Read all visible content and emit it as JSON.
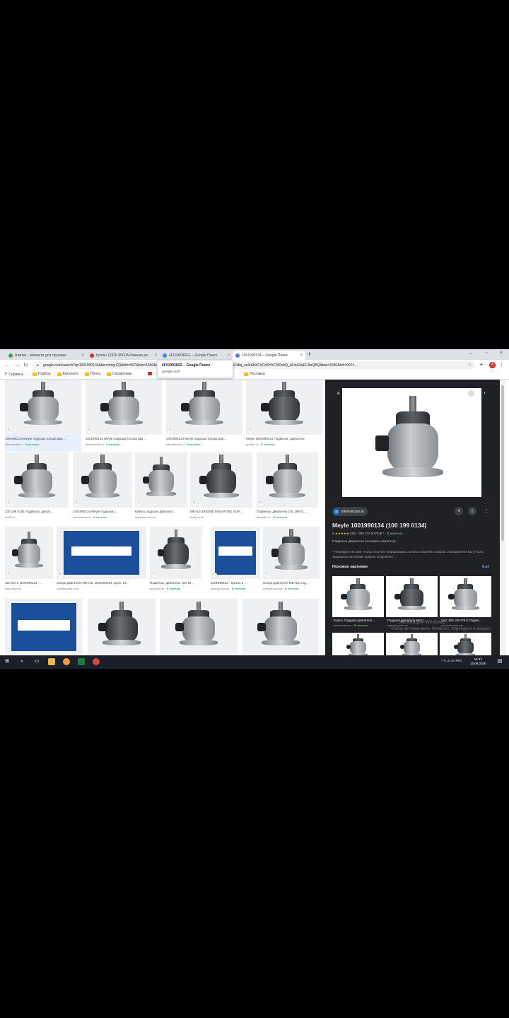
{
  "browser": {
    "tabs": [
      {
        "label": "Алитек - запчасти для грузовик",
        "color": "#34a853",
        "active": false
      },
      {
        "label": "Куплю 11920-95F0A Резинка ре",
        "color": "#d93025",
        "active": false
      },
      {
        "label": "4F0199381FL – Google Поиск",
        "color": "#4285f4",
        "active": false
      },
      {
        "label": "1001990134 – Google Поиск",
        "color": "#4285f4",
        "active": true
      }
    ],
    "new_tab": "+",
    "url": "google.com/search?q=1001990134&tbs=rimg:CQ&bih=907&biw=1680&ved=2ahUKEwi&tbm=isch&sa=X&ved=2ahUKEwiZ4bq_ve3rAhXFXCcKHXCNDukQ_AUoA3oECAsQBQ&biw=1680&bih=907#…",
    "bookmarks": [
      {
        "label": "Сервисы",
        "type": "grid"
      },
      {
        "label": "Подбор",
        "type": "folder"
      },
      {
        "label": "Каталоги",
        "type": "folder"
      },
      {
        "label": "Почта",
        "type": "folder"
      },
      {
        "label": "Справочник",
        "type": "folder"
      },
      {
        "label": "Поставка",
        "type": "folder"
      }
    ],
    "tooltip": {
      "title": "4F0199381R – Google Поиск",
      "domain": "google.com"
    }
  },
  "results": [
    {
      "caption": "1001990134 Meyle подушка (опора дви…",
      "source": "internetcars.ru",
      "stock": "В наличии",
      "style": "mount",
      "selected": true
    },
    {
      "caption": "1001990134 Meyle подушка (опора дви…",
      "source": "internetcars.ru",
      "stock": "В наличии",
      "style": "mount"
    },
    {
      "caption": "1001990134 Meyle подушка (опора дви…",
      "source": "internetcars.ru",
      "stock": "В наличии",
      "style": "mount"
    },
    {
      "caption": "Meyle 1001990134 Подвеска, двигатель",
      "source": "zpolitre.ru",
      "stock": "В наличии",
      "style": "mount"
    },
    {
      "caption": "100 199 0134 Подвеска, двигат…",
      "source": "port3.ru",
      "stock": "",
      "style": "mount"
    },
    {
      "caption": "1001990134 Meyle подушка (…",
      "source": "internetcars.ru",
      "stock": "В наличии",
      "style": "mount"
    },
    {
      "caption": "Купить подушка двигател…",
      "source": "avtoplus.com.ua",
      "stock": "",
      "style": "mount"
    },
    {
      "caption": "MEYLE ENGINE MOUNTING SUP…",
      "source": "ebay.co.uk",
      "stock": "",
      "style": "mount"
    },
    {
      "caption": "Подвеска, двигатель 100 199 01…",
      "source": "autoplex.ru",
      "stock": "В наличии",
      "style": "mount"
    },
    {
      "caption": "Запчасть 1001990134 -…",
      "source": "baza.dnpri.ru",
      "stock": "",
      "style": "mount"
    },
    {
      "caption": "Опора двигателя MEYLE 1001990134, цена: 14…",
      "source": "romeks-auto.com",
      "stock": "",
      "style": "box"
    },
    {
      "caption": "Подвеска, двигатель 100 19…",
      "source": "autoprim.ru",
      "stock": "В наличии",
      "style": "mount"
    },
    {
      "caption": "1001990134 - купить в …",
      "source": "zpolniy.com.ua",
      "stock": "В наличии",
      "style": "box"
    },
    {
      "caption": "Опора двигателя MEYLE ход…",
      "source": "meeple.com.ua",
      "stock": "В наличии",
      "style": "mount"
    },
    {
      "caption": "",
      "source": "",
      "stock": "",
      "style": "box"
    },
    {
      "caption": "",
      "source": "",
      "stock": "",
      "style": "mount"
    },
    {
      "caption": "",
      "source": "",
      "stock": "",
      "style": "mount"
    },
    {
      "caption": "",
      "source": "",
      "stock": "",
      "style": "mount"
    }
  ],
  "panel": {
    "site": "internetcars.ru",
    "title": "Meyle 1001990134 (100 199 0134)",
    "rating_value": "5",
    "stars": "★★★★★",
    "reviews": "(30)",
    "price": "398 104,20 RUB *",
    "stock": "В наличии",
    "description": "Подвеска двигателя (силового агрегата)",
    "notice": "* Перейдите на сайт, чтобы получить информацию о ценах и наличии товаров. Изображения могут быть защищены авторским правом. Подробнее…",
    "similar_heading": "Похожие картинки",
    "more_label": "Ещё",
    "similar": [
      {
        "caption": "Купить Подушка двигателя,…",
        "source": "avtoto.com.ua",
        "stock": "В наличии"
      },
      {
        "caption": "Подушка двигателя MEYL…",
        "source": "ukrparts.com.ua",
        "stock": ""
      },
      {
        "caption": "VAG 4B0 199 379 E Подвес…",
        "source": "oral-avto.com.ua",
        "stock": ""
      },
      {
        "caption": "",
        "source": "",
        "stock": ""
      },
      {
        "caption": "",
        "source": "",
        "stock": ""
      },
      {
        "caption": "",
        "source": "",
        "stock": ""
      }
    ],
    "watermark1": "Активация Windows",
    "watermark2": "Чтобы активировать Windows, перейдите в раздел"
  },
  "taskbar": {
    "tray_text": "^ ⊓ ⊿ ◁× РУС",
    "time": "15:37",
    "date": "16.09.2020"
  },
  "colors": {
    "accent": "#1a73e8",
    "panel_bg": "#202124",
    "ok_green": "#188038",
    "taskbar": "#1b1f2b"
  }
}
